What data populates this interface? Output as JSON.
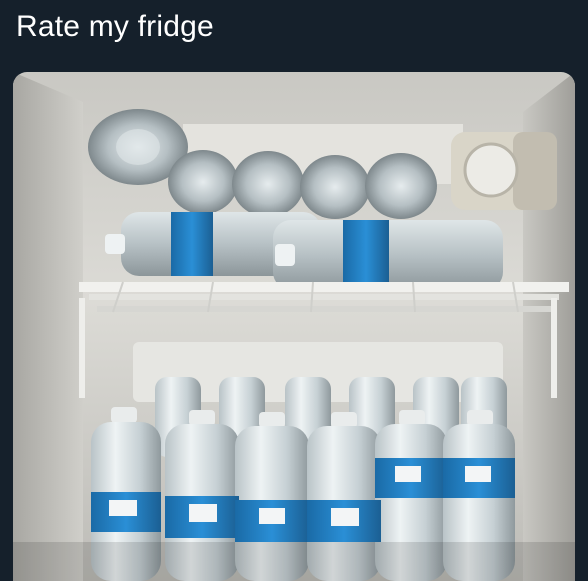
{
  "post": {
    "text": "Rate my fridge"
  },
  "photo": {
    "subject": "fridge-with-water-bottles",
    "colors": {
      "background": "#15202b",
      "fridge_interior": "#d9d8d3",
      "bottle_label": "#1f7fc4",
      "shelf": "#e9e9e6"
    }
  }
}
